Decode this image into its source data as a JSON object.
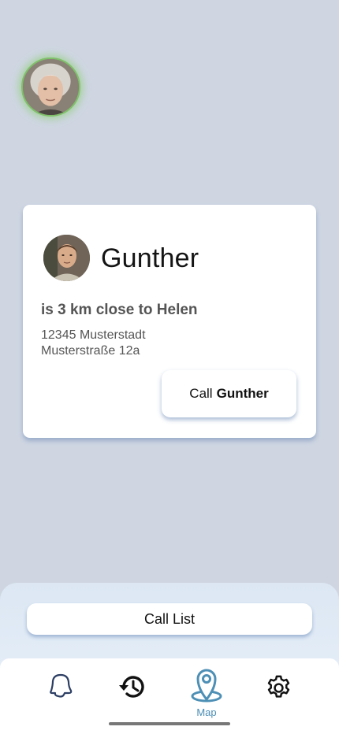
{
  "user": {
    "avatar": "elderly-woman-avatar"
  },
  "card": {
    "name": "Gunther",
    "distance_text": "is 3 km close to Helen",
    "address_line1": "12345 Musterstadt",
    "address_line2": "Musterstraße 12a",
    "call_prefix": "Call",
    "call_name": "Gunther"
  },
  "sheet": {
    "call_list_label": "Call List"
  },
  "nav": {
    "items": [
      {
        "icon": "bell-icon"
      },
      {
        "icon": "history-icon"
      },
      {
        "icon": "map-pin-icon",
        "label": "Map",
        "active": true
      },
      {
        "icon": "settings-gear-icon"
      }
    ]
  },
  "colors": {
    "background": "#cfd6e2",
    "accent": "#4d8fb5",
    "online_ring": "#7fc06a",
    "text_dark": "#141414",
    "text_muted": "#555555"
  }
}
